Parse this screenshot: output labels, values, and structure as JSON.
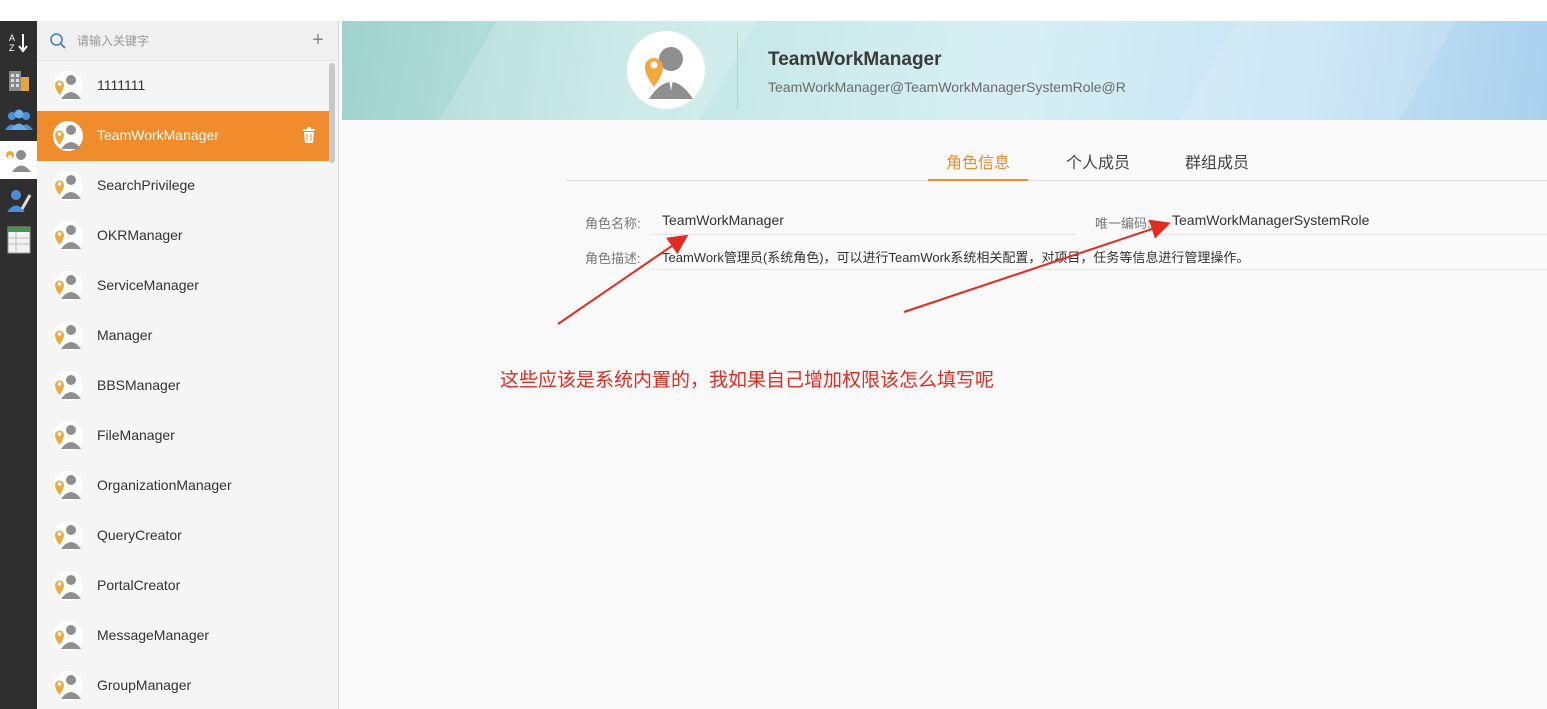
{
  "rail": {
    "items": [
      {
        "name": "sort-az-icon"
      },
      {
        "name": "building-icon"
      },
      {
        "name": "group-icon"
      },
      {
        "name": "role-icon",
        "active": true
      },
      {
        "name": "person-edit-icon"
      },
      {
        "name": "spreadsheet-icon"
      }
    ]
  },
  "search": {
    "placeholder": "请输入关键字",
    "add_icon": "plus-icon"
  },
  "roles": [
    {
      "label": "1111111"
    },
    {
      "label": "TeamWorkManager",
      "selected": true
    },
    {
      "label": "SearchPrivilege"
    },
    {
      "label": "OKRManager"
    },
    {
      "label": "ServiceManager"
    },
    {
      "label": "Manager"
    },
    {
      "label": "BBSManager"
    },
    {
      "label": "FileManager"
    },
    {
      "label": "OrganizationManager"
    },
    {
      "label": "QueryCreator"
    },
    {
      "label": "PortalCreator"
    },
    {
      "label": "MessageManager"
    },
    {
      "label": "GroupManager"
    }
  ],
  "header": {
    "title": "TeamWorkManager",
    "subtitle": "TeamWorkManager@TeamWorkManagerSystemRole@R"
  },
  "tabs": [
    {
      "label": "角色信息",
      "active": true
    },
    {
      "label": "个人成员"
    },
    {
      "label": "群组成员"
    }
  ],
  "form": {
    "name_label": "角色名称:",
    "name_value": "TeamWorkManager",
    "code_label": "唯一编码:",
    "code_value": "TeamWorkManagerSystemRole",
    "desc_label": "角色描述:",
    "desc_value": "TeamWork管理员(系统角色)，可以进行TeamWork系统相关配置，对项目，任务等信息进行管理操作。"
  },
  "annotation": {
    "text": "这些应该是系统内置的，我如果自己增加权限该怎么填写呢",
    "color": "#e52a1f"
  },
  "colors": {
    "accent": "#f08c2c",
    "rail": "#2f2f2f"
  }
}
